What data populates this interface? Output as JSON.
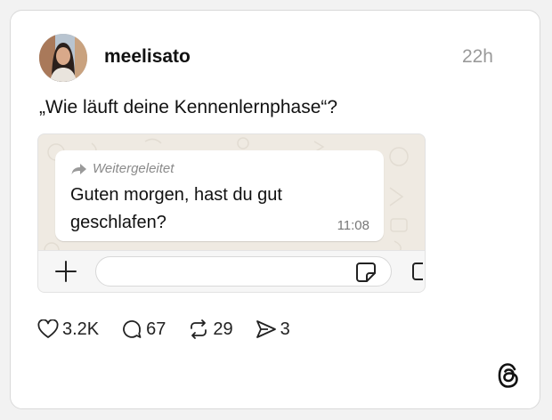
{
  "post": {
    "username": "meelisato",
    "time": "22h",
    "text": "„Wie läuft deine Kennenlernphase“?"
  },
  "chat": {
    "forwarded_label": "Weitergeleitet",
    "message_line1": "Guten morgen, hast du gut",
    "message_line2": "geschlafen?",
    "message_time": "11:08"
  },
  "actions": {
    "likes": "3.2K",
    "replies": "67",
    "reposts": "29",
    "shares": "3"
  },
  "icons": {
    "like": "heart-icon",
    "reply": "comment-icon",
    "repost": "repost-icon",
    "share": "send-icon",
    "logo": "threads-logo-icon"
  },
  "colors": {
    "chat_background": "#efeae2",
    "muted_text": "#9a9a9a"
  }
}
